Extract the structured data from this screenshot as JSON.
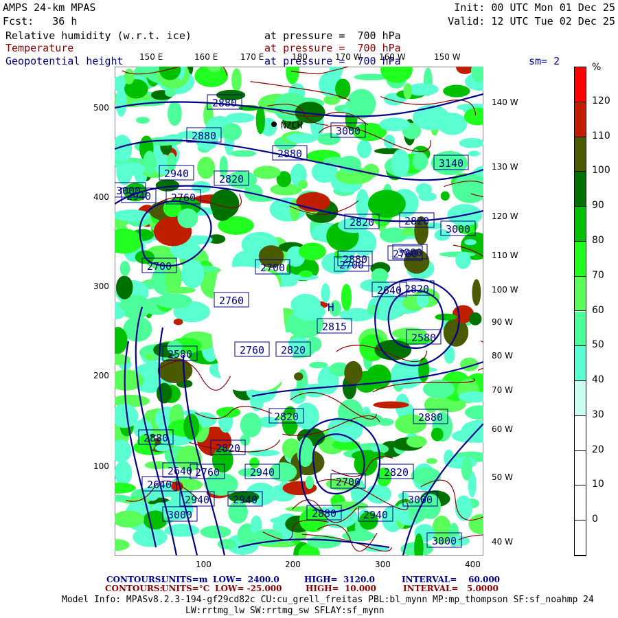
{
  "header": {
    "model": "AMPS 24-km MPAS",
    "forecast": "Fcst:   36 h",
    "init": "Init: 00 UTC Mon 01 Dec 25",
    "valid": "Valid: 12 UTC Tue 02 Dec 25",
    "fields": [
      {
        "name": "Relative humidity (w.r.t. ice)",
        "level": "at pressure =  700 hPa",
        "color": "#000000"
      },
      {
        "name": "Temperature",
        "level": "at pressure =  700 hPa",
        "color": "#8b0000"
      },
      {
        "name": "Geopotential height",
        "level": "at pressure =  700 hPa",
        "color": "#00008b"
      }
    ],
    "smoothing": "sm= 2"
  },
  "axes": {
    "top_lon": [
      "150 E",
      "160 E",
      "170 E",
      "180",
      "170 W",
      "160 W",
      "150 W"
    ],
    "right_lon": [
      "140 W",
      "130 W",
      "120 W",
      "110 W",
      "100 W",
      "90 W",
      "80 W",
      "70 W",
      "60 W",
      "50 W",
      "40 W"
    ],
    "left_y": [
      "500",
      "400",
      "300",
      "200",
      "100"
    ],
    "bottom_x": [
      "100",
      "200",
      "300",
      "400"
    ]
  },
  "map_labels": {
    "height": [
      "2880",
      "3000",
      "2880",
      "2940",
      "2820",
      "2940",
      "2760",
      "2820",
      "2880",
      "2820",
      "3000",
      "3000",
      "3140",
      "2700",
      "2760",
      "2820",
      "2760",
      "2700",
      "2640",
      "2815",
      "2580",
      "2760",
      "2700",
      "2580",
      "2820",
      "2880",
      "2880",
      "2640",
      "2820",
      "2640",
      "2700",
      "2760",
      "2820",
      "2940",
      "3000",
      "2940",
      "3000",
      "2880",
      "2940",
      "3000",
      "2880",
      "3000",
      "2940",
      "2820"
    ],
    "pressure_center_H": "H",
    "station": "NZCH"
  },
  "colorbar": {
    "unit": "%",
    "labels": [
      "120",
      "110",
      "100",
      "90",
      "80",
      "70",
      "60",
      "50",
      "40",
      "30",
      "20",
      "10",
      "0"
    ],
    "colors": [
      "#ff0000",
      "#c01e00",
      "#4a5a00",
      "#007000",
      "#00c000",
      "#20ff20",
      "#5aff5a",
      "#4dff9a",
      "#5affd2",
      "#c8fff0",
      "#ffffff",
      "#ffffff",
      "#ffffff",
      "#ffffff"
    ]
  },
  "footer": {
    "height_contours": {
      "label": "CONTOURS:",
      "units": "UNITS=m",
      "low": "LOW=  2400.0",
      "high": "HIGH=  3120.0",
      "interval": "INTERVAL=    60.000"
    },
    "temp_contours": {
      "label": "CONTOURS:",
      "units": "UNITS=°C",
      "low": "LOW= -25.000",
      "high": "HIGH=  10.000",
      "interval": "INTERVAL=   5.0000"
    },
    "model_info": "Model Info: MPASv8.2.3-194-gf29cd82c CU:cu_grell_freitas PBL:bl_mynn MP:mp_thompson SF:sf_noahmp 24",
    "model_info2": "LW:rrtmg_lw SW:rrtmg_sw SFLAY:sf_mynn"
  }
}
